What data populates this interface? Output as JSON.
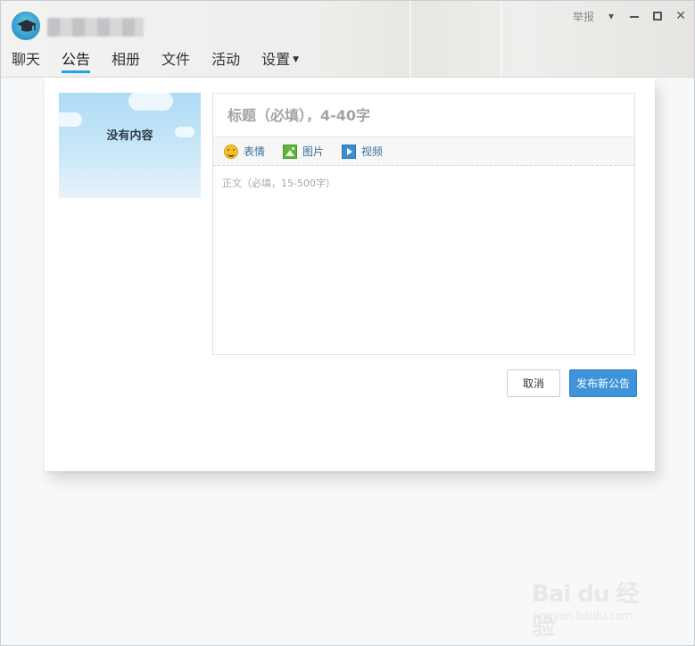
{
  "window": {
    "report_label": "举报",
    "tabs": [
      {
        "label": "聊天",
        "active": false
      },
      {
        "label": "公告",
        "active": true
      },
      {
        "label": "相册",
        "active": false
      },
      {
        "label": "文件",
        "active": false
      },
      {
        "label": "活动",
        "active": false
      },
      {
        "label": "设置",
        "active": false,
        "has_dropdown": true
      }
    ]
  },
  "announcement_list": {
    "empty_text": "没有内容"
  },
  "editor": {
    "title_placeholder": "标题（必填），4-40字",
    "title_value": "",
    "toolbar": {
      "emoji_label": "表情",
      "image_label": "图片",
      "video_label": "视频"
    },
    "body_placeholder": "正文（必填，15-500字）",
    "body_value": ""
  },
  "actions": {
    "cancel_label": "取消",
    "publish_label": "发布新公告"
  },
  "watermark": {
    "brand": "Bai du 经验",
    "url": "jingyan.baidu.com"
  },
  "colors": {
    "accent": "#1ea5e0",
    "publish_button": "#3d94db"
  },
  "icons": {
    "avatar": "graduation-cap-icon",
    "dropdown": "caret-down-icon",
    "minimize": "minimize-icon",
    "maximize": "maximize-icon",
    "close": "close-icon",
    "emoji": "smiley-icon",
    "image": "image-icon",
    "video": "video-play-icon"
  }
}
